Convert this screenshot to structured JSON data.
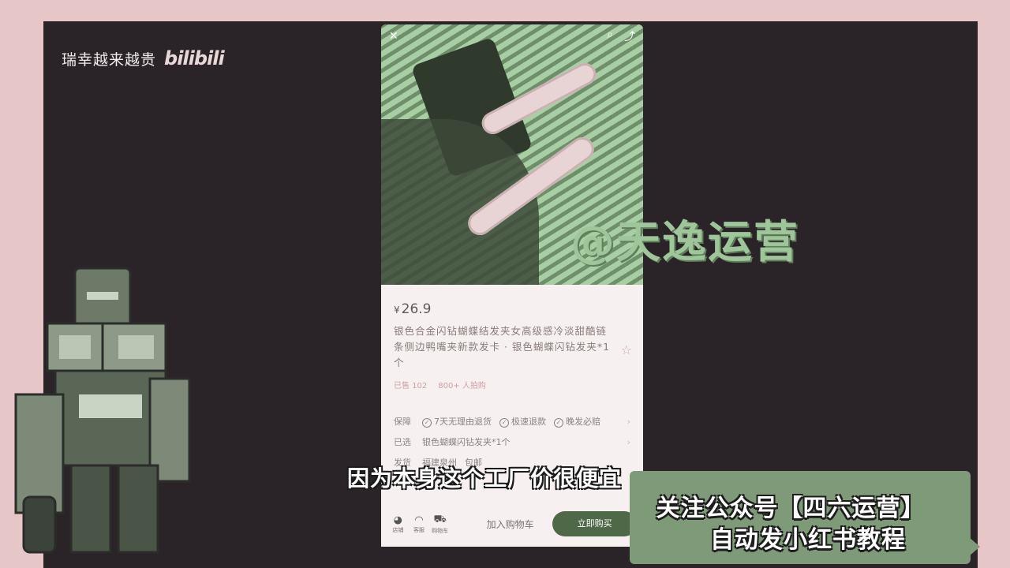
{
  "brand": {
    "handle": "瑞幸越来越贵",
    "logo": "bilibili"
  },
  "phone": {
    "topbar": {
      "close": "✕",
      "search": "⌕",
      "share": "⤴"
    },
    "product": {
      "currency": "¥",
      "price": "26.9",
      "title": "银色合金闪钻蝴蝶结发夹女高级感冷淡甜酷链条侧边鸭嘴夹新款发卡 · 银色蝴蝶闪钻发夹*1个",
      "sold": "已售 102",
      "bought": "800+ 人拍购"
    },
    "rows": [
      {
        "key": "保障",
        "items": [
          "7天无理由退货",
          "极速退款",
          "晚发必赔"
        ]
      },
      {
        "key": "已选",
        "items": [
          "银色蝴蝶闪钻发夹*1个"
        ]
      },
      {
        "key": "发货",
        "items": [
          "福建泉州",
          "包邮"
        ]
      }
    ],
    "bottom": {
      "shop_label": "店铺",
      "service_label": "客服",
      "cart_label": "购物车",
      "add_to_cart": "加入购物车",
      "buy_now": "立即购买"
    }
  },
  "overlays": {
    "watermark": "@天逸运营",
    "subtitle": "因为本身这个工厂价很便宜",
    "promo_line1": "关注公众号【四六运营】",
    "promo_line2": "自动发小红书教程"
  },
  "colors": {
    "background": "#e7c6c8",
    "stage": "#2a2428",
    "accent_green": "#4f6848",
    "promo_bg": "#7f9a78"
  }
}
